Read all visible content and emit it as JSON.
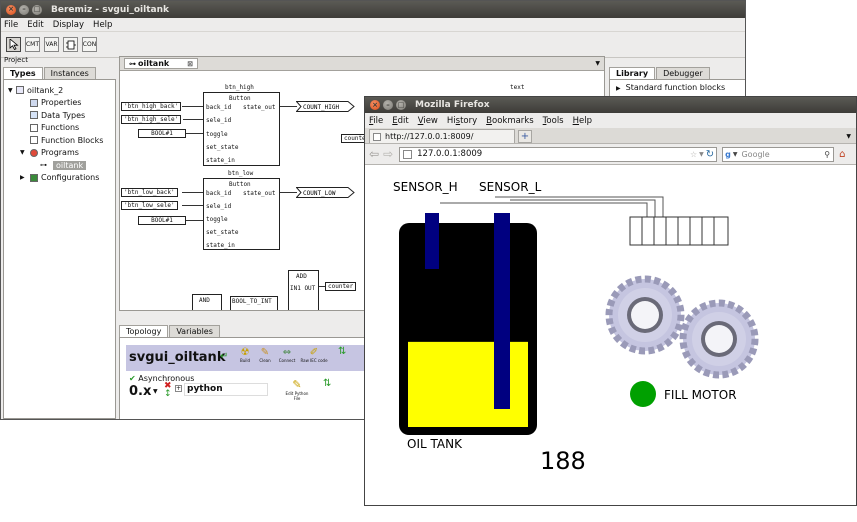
{
  "beremiz": {
    "title": "Beremiz - svgui_oiltank",
    "menu": [
      "File",
      "Edit",
      "Display",
      "Help"
    ],
    "toolbar_icons": [
      "pointer-tool-icon",
      "comment-tool-icon",
      "variable-tool-icon",
      "block-tool-icon",
      "connection-tool-icon"
    ],
    "toolbar_texts": {
      "cmt": "CMT",
      "var": "VAR",
      "con": "CON"
    },
    "project_label": "Project",
    "tabs": [
      "Types",
      "Instances"
    ],
    "tree": {
      "root": "oiltank_2",
      "properties": "Properties",
      "data_types": "Data Types",
      "functions": "Functions",
      "function_blocks": "Function Blocks",
      "programs": "Programs",
      "program_item": "oiltank",
      "configurations": "Configurations"
    },
    "editor_tab": "oiltank",
    "diagram": {
      "btn_high_name": "btn_high",
      "btn_low_name": "btn_low",
      "block_type": "Button",
      "pins_in": [
        "back_id",
        "sele_id",
        "toggle",
        "set_state",
        "state_in"
      ],
      "pin_out": "state_out",
      "high_inputs": [
        "'btn_high_back'",
        "'btn_high_sele'",
        "BOOL#1"
      ],
      "low_inputs": [
        "'btn_low_back'",
        "'btn_low_sele'",
        "BOOL#1"
      ],
      "count_high": "COUNT_HIGH",
      "count_low": "COUNT_LOW",
      "add_label": "ADD",
      "add_pins": "IN1 OUT",
      "counter": "counter",
      "counte_trunc": "counte",
      "text_label": "text",
      "and_label": "AND",
      "bool_to_int": "BOOL_TO_INT"
    },
    "bottom_tabs": [
      "Topology",
      "Variables"
    ],
    "topology": {
      "project": "svgui_oiltank",
      "actions": [
        "Build",
        "Clean",
        "Connect",
        "Raw IEC code"
      ],
      "asynchronous": "Asynchronous",
      "version": "0.x",
      "plugin": "python",
      "edit_python": "Edit Python File"
    },
    "library_tabs": [
      "Library",
      "Debugger"
    ],
    "library_item": "Standard function blocks"
  },
  "firefox": {
    "title": "Mozilla Firefox",
    "menu": [
      "File",
      "Edit",
      "View",
      "History",
      "Bookmarks",
      "Tools",
      "Help"
    ],
    "menu_ul": [
      "F",
      "E",
      "V",
      "s",
      "B",
      "T",
      "H"
    ],
    "tab_label": "http://127.0.0.1:8009/",
    "url": "127.0.0.1:8009",
    "search_placeholder": "Google",
    "hmi": {
      "sensor_h": "SENSOR_H",
      "sensor_l": "SENSOR_L",
      "oil_tank": "OIL TANK",
      "counter_value": "188",
      "fill_motor": "FILL MOTOR",
      "oil_level": 0.43,
      "colors": {
        "tank": "#000000",
        "oil": "#ffff00",
        "sensor": "#000080",
        "motor_led": "#00a000"
      }
    }
  }
}
